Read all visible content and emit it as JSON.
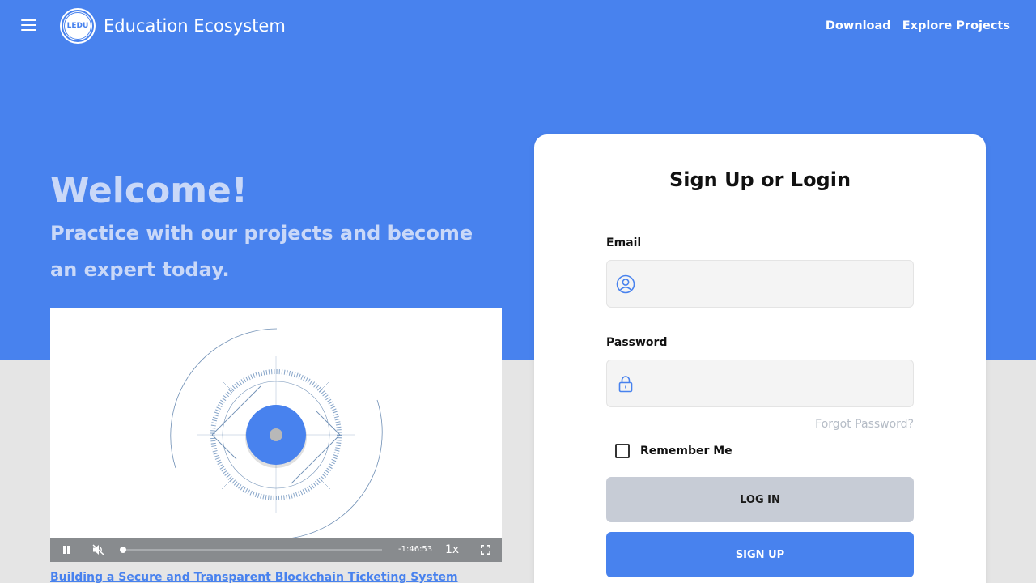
{
  "colors": {
    "brand_blue": "#4882ee",
    "hero_text": "#c9d8f8",
    "page_bg": "#e5e5e5",
    "login_button_bg": "#c7ccd6"
  },
  "header": {
    "menu_icon": "hamburger-menu-icon",
    "logo_text": "LEDU",
    "brand": "Education Ecosystem",
    "nav": [
      "Download",
      "Explore Projects"
    ]
  },
  "hero": {
    "title": "Welcome!",
    "subtitle": "Practice with our projects and become an expert today."
  },
  "video": {
    "controls": {
      "play_pause_icon": "pause-icon",
      "mute_icon": "muted-speaker-icon",
      "progress": 0.0,
      "time_remaining": "-1:46:53",
      "speed": "1x",
      "fullscreen_icon": "fullscreen-icon"
    },
    "caption": "Building a Secure and Transparent Blockchain Ticketing System"
  },
  "auth": {
    "title": "Sign Up or Login",
    "email": {
      "label": "Email",
      "value": "",
      "placeholder": "",
      "icon": "user-circle-icon"
    },
    "password": {
      "label": "Password",
      "value": "",
      "placeholder": "",
      "icon": "lock-icon"
    },
    "forgot": "Forgot Password?",
    "remember": {
      "label": "Remember Me",
      "checked": false
    },
    "login_button": "LOG IN",
    "signup_button": "SIGN UP"
  }
}
